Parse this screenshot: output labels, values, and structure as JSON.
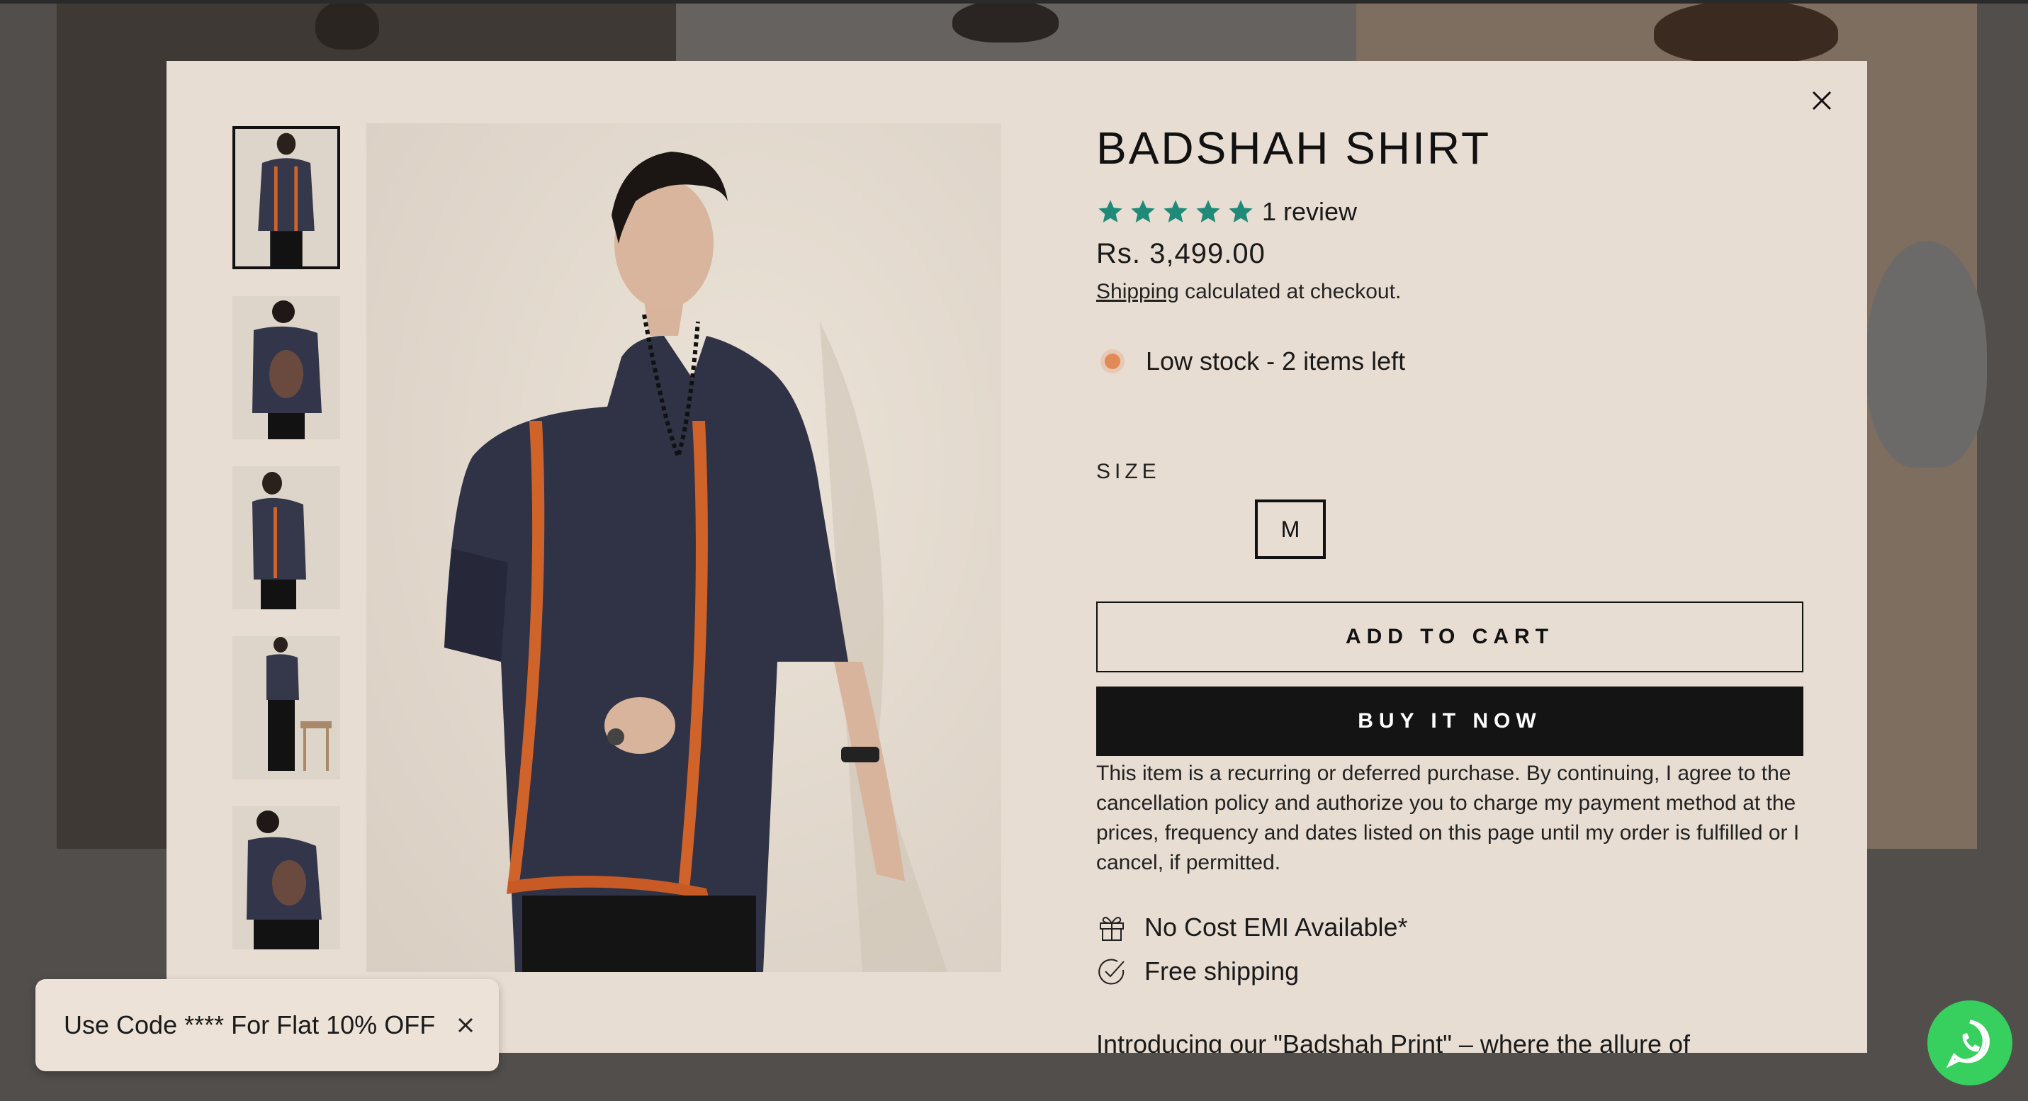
{
  "product": {
    "title": "BADSHAH SHIRT",
    "rating_stars": 5,
    "review_count": "1 review",
    "price": "Rs. 3,499.00",
    "shipping_link": "Shipping",
    "shipping_suffix": " calculated at checkout.",
    "stock_status": "Low stock - 2 items left",
    "size_label": "SIZE",
    "sizes": [
      "M"
    ],
    "selected_size": "M",
    "add_to_cart": "ADD TO CART",
    "buy_now": "BUY IT NOW",
    "disclaimer": "This item is a recurring or deferred purchase. By continuing, I agree to the cancellation policy and authorize you to charge my payment method at the prices, frequency and dates listed on this page until my order is fulfilled or I cancel, if permitted.",
    "features": [
      {
        "icon": "gift-icon",
        "label": "No Cost EMI Available*"
      },
      {
        "icon": "check-circle-icon",
        "label": "Free shipping"
      }
    ],
    "description_start": "Introducing our \"Badshah Print\" – where the allure of"
  },
  "gallery": {
    "thumbnail_count": 5,
    "active_index": 0
  },
  "promo": {
    "text": "Use Code **** For Flat 10% OFF"
  },
  "colors": {
    "modal_bg": "#e8ddd2",
    "star": "#1f8a78",
    "stock_dot": "#e28a57",
    "buy_now_bg": "#141414",
    "whatsapp": "#37d05e"
  }
}
